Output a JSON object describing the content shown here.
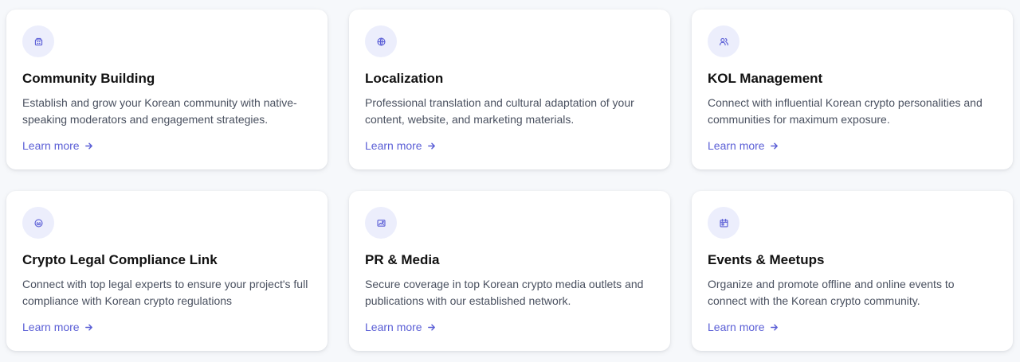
{
  "colors": {
    "page_background": "#f6f8fb",
    "card_background": "#ffffff",
    "accent": "#5b5fd6",
    "icon_background": "#eceefc",
    "title": "#111111",
    "description": "#4a5160"
  },
  "services": [
    {
      "icon": "building-icon",
      "title": "Community Building",
      "description": "Establish and grow your Korean community with native-speaking moderators and engagement strategies.",
      "link_label": "Learn more"
    },
    {
      "icon": "globe-icon",
      "title": "Localization",
      "description": "Professional translation and cultural adaptation of your content, website, and marketing materials.",
      "link_label": "Learn more"
    },
    {
      "icon": "users-icon",
      "title": "KOL Management",
      "description": "Connect with influential Korean crypto personalities and communities for maximum exposure.",
      "link_label": "Learn more"
    },
    {
      "icon": "scale-icon",
      "title": "Crypto Legal Compliance Link",
      "description": "Connect with top legal experts to ensure your project's full compliance with Korean crypto regulations",
      "link_label": "Learn more"
    },
    {
      "icon": "media-icon",
      "title": "PR & Media",
      "description": "Secure coverage in top Korean crypto media outlets and publications with our established network.",
      "link_label": "Learn more"
    },
    {
      "icon": "calendar-icon",
      "title": "Events & Meetups",
      "description": "Organize and promote offline and online events to connect with the Korean crypto community.",
      "link_label": "Learn more"
    }
  ]
}
